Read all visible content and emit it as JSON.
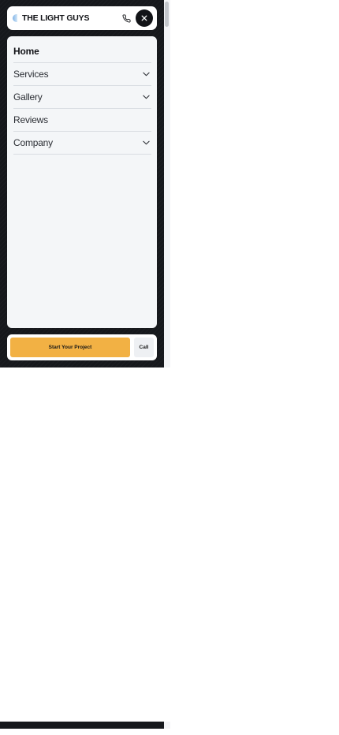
{
  "header": {
    "brand": "THE LIGHT GUYS",
    "phone_icon": "phone-icon",
    "close_icon": "close-icon"
  },
  "menu": {
    "items": [
      {
        "label": "Home",
        "active": true,
        "has_submenu": false
      },
      {
        "label": "Services",
        "active": false,
        "has_submenu": true
      },
      {
        "label": "Gallery",
        "active": false,
        "has_submenu": true
      },
      {
        "label": "Reviews",
        "active": false,
        "has_submenu": false
      },
      {
        "label": "Company",
        "active": false,
        "has_submenu": true
      }
    ]
  },
  "cta": {
    "primary_label": "Start Your Project",
    "call_label": "Call"
  },
  "colors": {
    "background_dark": "#16181c",
    "panel": "#f4f6f8",
    "accent": "#f2b144",
    "text_dark": "#121317"
  }
}
